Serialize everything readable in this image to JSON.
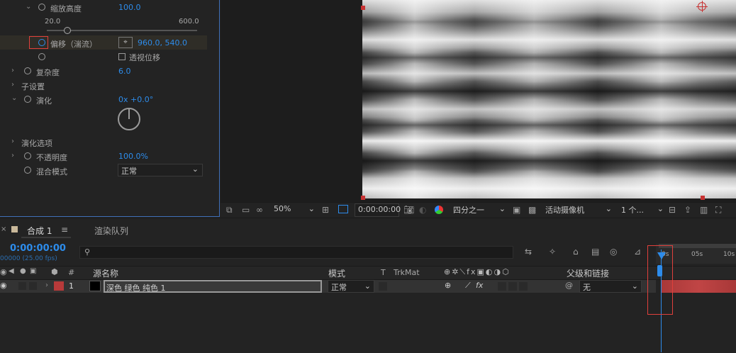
{
  "effects": {
    "scale_height": {
      "label": "缩放高度",
      "value": "100.0"
    },
    "slider": {
      "min": "20.0",
      "max": "600.0",
      "fraction": 0.13
    },
    "offset": {
      "label": "偏移（湍流）",
      "value": "960.0, 540.0"
    },
    "perspective": {
      "label": "透视位移"
    },
    "complexity": {
      "label": "复杂度",
      "value": "6.0"
    },
    "sub_settings": {
      "label": "子设置"
    },
    "evolution": {
      "label": "演化",
      "value": "0x +0.0°"
    },
    "evolution_options": {
      "label": "演化选项"
    },
    "opacity": {
      "label": "不透明度",
      "value": "100.0%"
    },
    "blend_mode": {
      "label": "混合模式",
      "value": "正常"
    }
  },
  "viewer_toolbar": {
    "zoom": "50%",
    "timecode": "0:00:00:00",
    "resolution": "四分之一",
    "camera": "活动摄像机",
    "views": "1 个..."
  },
  "timeline": {
    "tab_comp": "合成 1",
    "tab_render": "渲染队列",
    "timecode": "0:00:00:00",
    "frames": "00000 (25.00 fps)",
    "search_placeholder": "",
    "headers": {
      "hash": "#",
      "source_name": "源名称",
      "mode": "模式",
      "t": "T",
      "trkmat": "TrkMat",
      "parent": "父级和链接"
    },
    "ruler": [
      "0s",
      "05s",
      "10s"
    ],
    "layer": {
      "number": "1",
      "name": "深色 绿色 纯色 1",
      "mode": "正常",
      "parent": "无",
      "color": "#b83a3a"
    }
  },
  "colors": {
    "accent": "#2d8ceb",
    "highlight": "#e0403c"
  }
}
